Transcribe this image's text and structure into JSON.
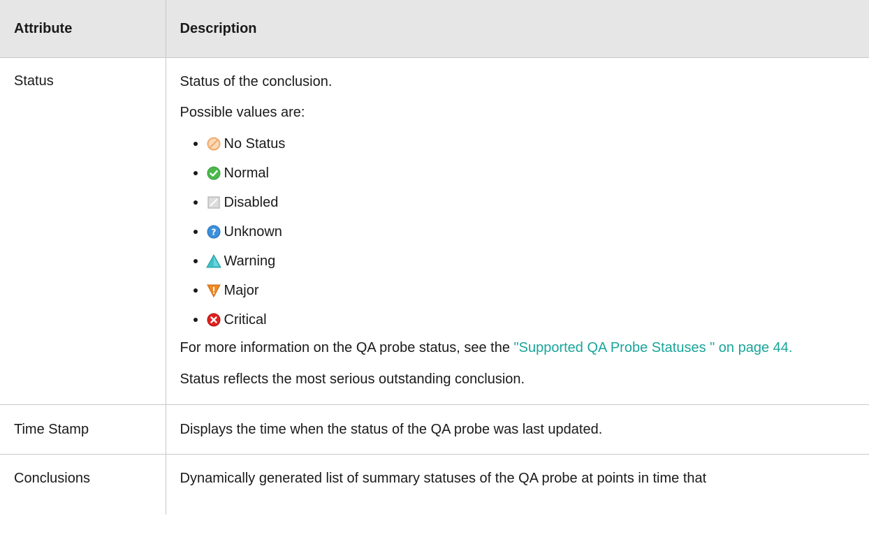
{
  "table": {
    "headers": {
      "attribute": "Attribute",
      "description": "Description"
    },
    "status_row": {
      "attribute": "Status",
      "desc_intro": "Status of the conclusion.",
      "possible_values_label": "Possible values are:",
      "values": [
        {
          "label": "No Status",
          "icon": "no-status-icon",
          "color": "#f0a868"
        },
        {
          "label": "Normal",
          "icon": "normal-icon",
          "color": "#4cb84c"
        },
        {
          "label": "Disabled",
          "icon": "disabled-icon",
          "color": "#b0b0b0"
        },
        {
          "label": "Unknown",
          "icon": "unknown-icon",
          "color": "#3b8fdb"
        },
        {
          "label": "Warning",
          "icon": "warning-icon",
          "color": "#3fc1c9"
        },
        {
          "label": "Major",
          "icon": "major-icon",
          "color": "#f08a24"
        },
        {
          "label": "Critical",
          "icon": "critical-icon",
          "color": "#e02020"
        }
      ],
      "more_info_prefix": "For more information on the QA probe status, see the ",
      "more_info_link": "\"Supported QA Probe Statuses \" on page 44.",
      "reflects": "Status reflects the most serious outstanding conclusion."
    },
    "timestamp_row": {
      "attribute": "Time Stamp",
      "description": "Displays the time when the status of the QA probe was last updated."
    },
    "conclusions_row": {
      "attribute": "Conclusions",
      "description": "Dynamically generated list of summary statuses of the QA probe at points in time that"
    }
  },
  "colors": {
    "header_bg": "#e6e6e6",
    "border": "#c8c8c8",
    "link": "#1aa59a"
  }
}
